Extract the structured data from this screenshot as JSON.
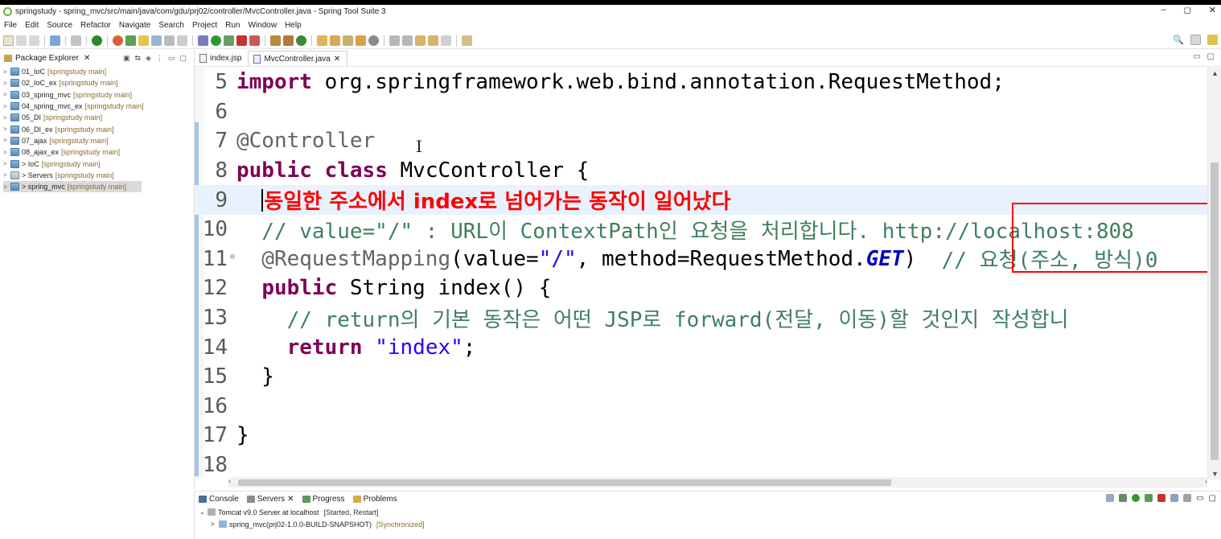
{
  "window": {
    "title": "springstudy - spring_mvc/src/main/java/com/gdu/prj02/controller/MvcController.java - Spring Tool Suite 3",
    "controls": [
      "–",
      "◻",
      "✕"
    ]
  },
  "menu": [
    "File",
    "Edit",
    "Source",
    "Refactor",
    "Navigate",
    "Search",
    "Project",
    "Run",
    "Window",
    "Help"
  ],
  "explorer": {
    "tab_label": "Package Explorer",
    "projects": [
      {
        "name": "01_IoC",
        "ctx": "[springstudy main]"
      },
      {
        "name": "02_IoC_ex",
        "ctx": "[springstudy main]"
      },
      {
        "name": "03_spring_mvc",
        "ctx": "[springstudy main]"
      },
      {
        "name": "04_spring_mvc_ex",
        "ctx": "[springstudy main]"
      },
      {
        "name": "05_DI",
        "ctx": "[springstudy main]"
      },
      {
        "name": "06_DI_ex",
        "ctx": "[springstudy main]"
      },
      {
        "name": "07_ajax",
        "ctx": "[springstudy main]"
      },
      {
        "name": "08_ajax_ex",
        "ctx": "[springstudy main]"
      },
      {
        "name": "> IoC",
        "ctx": "[springstudy main]"
      },
      {
        "name": "> Servers",
        "ctx": "[springstudy main]"
      },
      {
        "name": "> spring_mvc",
        "ctx": "[springstudy main]"
      }
    ]
  },
  "editor": {
    "tabs": [
      {
        "label": "index.jsp"
      },
      {
        "label": "MvcController.java"
      }
    ],
    "lines": {
      "l5": {
        "num": "5",
        "kw": "import",
        "rest": " org.springframework.web.bind.annotation.RequestMethod;"
      },
      "l6": {
        "num": "6"
      },
      "l7": {
        "num": "7",
        "ann": "@Controller"
      },
      "l8": {
        "num": "8",
        "kw1": "public",
        "kw2": "class",
        "rest": " MvcController {"
      },
      "l9": {
        "num": "9",
        "overlay": "동일한 주소에서 index로 넘어가는 동작이 일어났다"
      },
      "l10": {
        "num": "10",
        "comment": "  // value=\"/\" : URL이 ContextPath인 요청을 처리합니다. http://localhost:808"
      },
      "l11": {
        "num": "11",
        "ann": "  @RequestMapping",
        "p1": "(value=",
        "str": "\"/\"",
        "p2": ", method=RequestMethod.",
        "cst": "GET",
        "p3": ")  ",
        "comment": "// 요청(주소, 방식)0"
      },
      "l12": {
        "num": "12",
        "kw": "public",
        "rest": " String index() {"
      },
      "l13": {
        "num": "13",
        "comment": "    // return의 기본 동작은 어떤 JSP로 forward(전달, 이동)할 것인지 작성합니"
      },
      "l14": {
        "num": "14",
        "kw": "return",
        "str": "\"index\"",
        "rest": ";"
      },
      "l15": {
        "num": "15",
        "rest": "  }"
      },
      "l16": {
        "num": "16"
      },
      "l17": {
        "num": "17",
        "rest": "}"
      },
      "l18": {
        "num": "18"
      }
    }
  },
  "bottom_panel": {
    "tabs": [
      "Console",
      "Servers",
      "Progress",
      "Problems"
    ],
    "server_row": {
      "name": "Tomcat v9.0 Server at localhost",
      "status": "[Started, Restart]"
    },
    "module_row": {
      "name": "spring_mvc(prj02-1.0.0-BUILD-SNAPSHOT)",
      "status": "[Synchronized]"
    }
  },
  "colors": {
    "keyword": "#7f0055",
    "comment": "#3f7f5f",
    "string": "#2a00ff",
    "annotation_overlay": "#ff0000",
    "current_line": "#e8f2fe"
  }
}
